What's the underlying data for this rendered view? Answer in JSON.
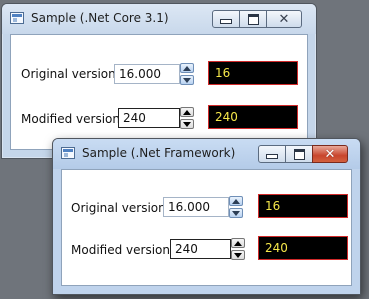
{
  "colors": {
    "output_text": "#f5e74a",
    "output_border": "#d12a2a",
    "output_background": "#000000"
  },
  "windows": [
    {
      "title": "Sample (.Net Core 3.1)",
      "icon": "window-app-icon",
      "caption_buttons": {
        "minimize": "minimize-icon",
        "maximize": "maximize-icon",
        "close": "close-icon"
      },
      "original": {
        "label": "Original version:",
        "value": "16.000",
        "output": "16"
      },
      "modified": {
        "label": "Modified version:",
        "value": "240",
        "output": "240"
      }
    },
    {
      "title": "Sample (.Net Framework)",
      "icon": "window-app-icon",
      "caption_buttons": {
        "minimize": "minimize-icon",
        "maximize": "maximize-icon",
        "close": "close-icon"
      },
      "original": {
        "label": "Original version:",
        "value": "16.000",
        "output": "16"
      },
      "modified": {
        "label": "Modified version:",
        "value": "240",
        "output": "240"
      }
    }
  ]
}
